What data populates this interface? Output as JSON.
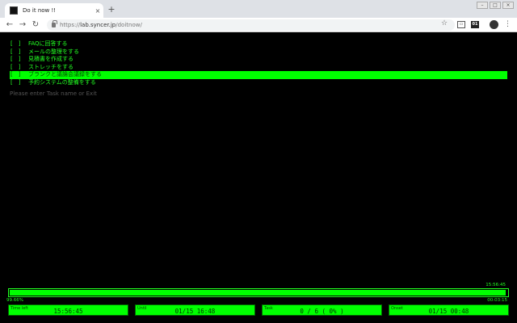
{
  "browser": {
    "tab_title": "Do it now !!",
    "tab_close": "×",
    "new_tab": "+",
    "url_prefix": "https://",
    "url_host": "lab.syncer.jp",
    "url_path": "/doitnow/",
    "ext2_label": "01"
  },
  "tasks": [
    {
      "check": "[　]",
      "label": "FAQに回答する",
      "selected": false
    },
    {
      "check": "[　]",
      "label": "メールの整理をする",
      "selected": false
    },
    {
      "check": "[　]",
      "label": "見積書を作成する",
      "selected": false
    },
    {
      "check": "[　]",
      "label": "ストレッチをする",
      "selected": false
    },
    {
      "check": "[　]",
      "label": "ブランクと議論会議録をする",
      "selected": true
    },
    {
      "check": "[　]",
      "label": "予約システムの整備をする",
      "selected": false
    }
  ],
  "prompt": "Please enter Task name or Exit",
  "timer": {
    "top_time": "15:56:45",
    "percent": "99.66%",
    "right_time": "00:03:15",
    "progress_fraction": 0.9966
  },
  "stats": [
    {
      "label": "Time left",
      "value": "15:56:45"
    },
    {
      "label": "Until",
      "value": "01/15 16:48"
    },
    {
      "label": "Task",
      "value": "0 / 6 ( 0% )"
    },
    {
      "label": "Onset",
      "value": "01/15 00:48"
    }
  ],
  "colors": {
    "accent": "#00ff00",
    "background": "#000000",
    "text": "#22ff22"
  }
}
